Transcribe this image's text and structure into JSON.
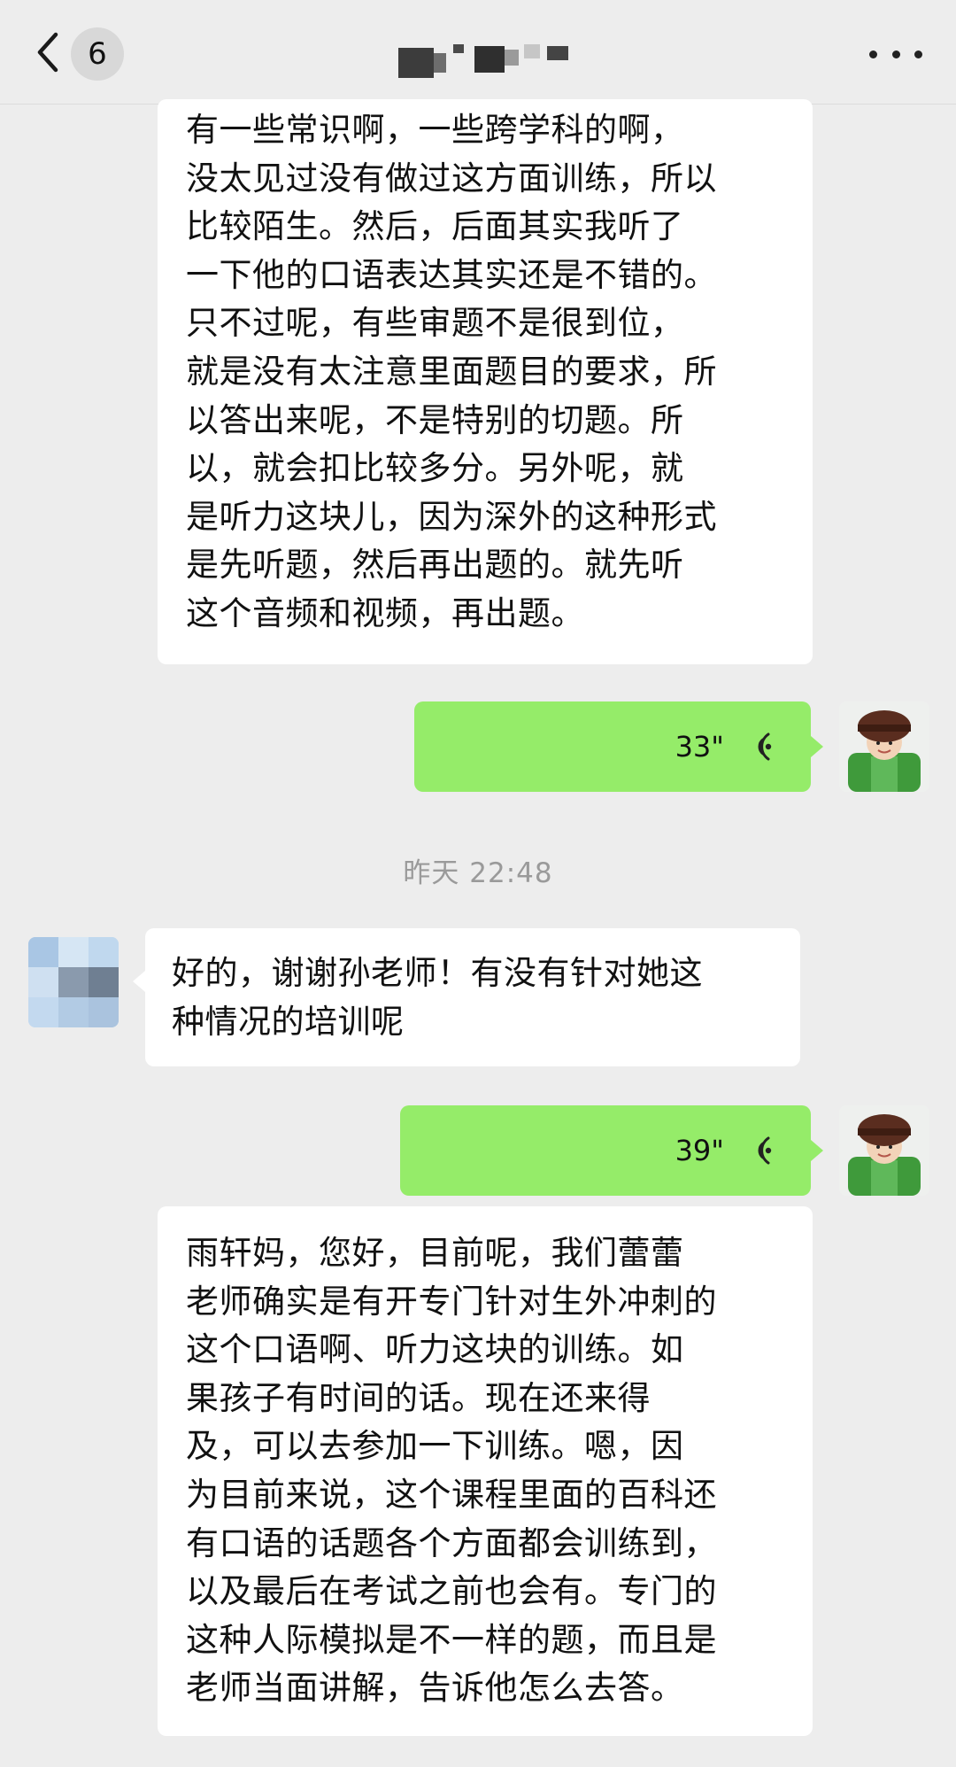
{
  "header": {
    "unread_count": "6",
    "back_icon": "chevron-left-icon",
    "more_icon": "more-dots-icon"
  },
  "messages": [
    {
      "side": "left",
      "type": "text",
      "text": "有一些常识啊，一些跨学科的啊，\n没太见过没有做过这方面训练，所以\n比较陌生。然后，后面其实我听了\n一下他的口语表达其实还是不错的。\n只不过呢，有些审题不是很到位，\n就是没有太注意里面题目的要求，所\n以答出来呢，不是特别的切题。所\n以，就会扣比较多分。另外呢，就\n是听力这块儿，因为深外的这种形式\n是先听题，然后再出题的。就先听\n这个音频和视频，再出题。"
    },
    {
      "side": "right",
      "type": "voice",
      "duration": "33\""
    },
    {
      "type": "timestamp",
      "text": "昨天 22:48"
    },
    {
      "side": "left",
      "type": "text",
      "text": "好的，谢谢孙老师！有没有针对她这\n种情况的培训呢"
    },
    {
      "side": "right",
      "type": "voice",
      "duration": "39\""
    },
    {
      "side": "left",
      "type": "text",
      "text": "雨轩妈，您好，目前呢，我们蕾蕾\n老师确实是有开专门针对生外冲刺的\n这个口语啊、听力这块的训练。如\n果孩子有时间的话。现在还来得\n及，可以去参加一下训练。嗯，因\n为目前来说，这个课程里面的百科还\n有口语的话题各个方面都会训练到，\n以及最后在考试之前也会有。专门的\n这种人际模拟是不一样的题，而且是\n老师当面讲解，告诉他怎么去答。"
    }
  ],
  "colors": {
    "background": "#ededed",
    "bubble_self": "#95ec69",
    "bubble_other": "#ffffff"
  }
}
